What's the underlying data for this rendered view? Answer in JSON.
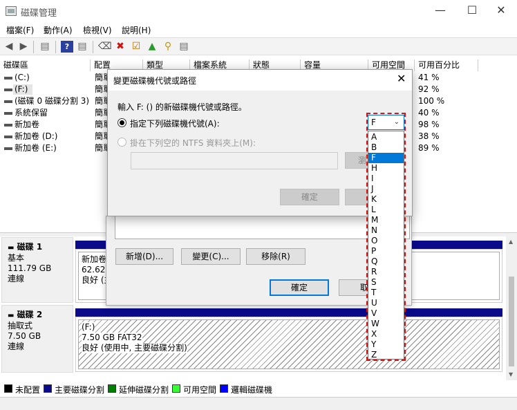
{
  "window": {
    "title": "磁碟管理",
    "minimize": "—",
    "maximize": "☐",
    "close": "✕"
  },
  "menu": [
    "檔案(F)",
    "動作(A)",
    "檢視(V)",
    "說明(H)"
  ],
  "volume_columns": [
    "磁碟區",
    "配置",
    "類型",
    "檔案系統",
    "狀態",
    "容量",
    "可用空間",
    "可用百分比"
  ],
  "volumes": [
    {
      "name": "(C:)",
      "layout": "簡單",
      "pct": "41 %"
    },
    {
      "name": "(F:)",
      "layout": "簡單",
      "pct": "92 %"
    },
    {
      "name": "(磁碟 0 磁碟分割 3)",
      "layout": "簡單",
      "pct": "100 %"
    },
    {
      "name": "系統保留",
      "layout": "簡單",
      "pct": "40 %"
    },
    {
      "name": "新加卷",
      "layout": "簡單",
      "pct": "98 %"
    },
    {
      "name": "新加卷 (D:)",
      "layout": "簡單",
      "pct": "38 %"
    },
    {
      "name": "新加卷 (E:)",
      "layout": "簡單",
      "pct": "89 %"
    }
  ],
  "disks": [
    {
      "title": "磁碟 1",
      "type": "基本",
      "size": "111.79 GB",
      "status": "連線",
      "part_name": "新加卷",
      "part_size": "62.62 G",
      "part_status": "良好 (主"
    },
    {
      "title": "磁碟 2",
      "type": "抽取式",
      "size": "7.50 GB",
      "status": "連線",
      "part_name": "(F:)",
      "part_size": "7.50 GB FAT32",
      "part_status": "良好 (使用中, 主要磁碟分割)"
    }
  ],
  "legend": [
    {
      "label": "未配置",
      "color": "#000000"
    },
    {
      "label": "主要磁碟分割",
      "color": "#0a0a8a"
    },
    {
      "label": "延伸磁碟分割",
      "color": "#008000"
    },
    {
      "label": "可用空間",
      "color": "#33ff33"
    },
    {
      "label": "邏輯磁碟機",
      "color": "#0000ff"
    }
  ],
  "props_dialog": {
    "add": "新增(D)...",
    "change": "變更(C)...",
    "remove": "移除(R)",
    "ok": "確定",
    "cancel": "取"
  },
  "dialog": {
    "title": "變更磁碟機代號或路徑",
    "close": "✕",
    "prompt": "輸入 F: () 的新磁碟機代號或路徑。",
    "opt_letter": "指定下列磁碟機代號(A):",
    "opt_folder": "掛在下列空的 NTFS 資料夾上(M):",
    "browse": "瀏",
    "ok": "確定",
    "cancel": ""
  },
  "dropdown": {
    "selected": "F",
    "options": [
      "A",
      "B",
      "F",
      "H",
      "I",
      "J",
      "K",
      "L",
      "M",
      "N",
      "O",
      "P",
      "Q",
      "R",
      "S",
      "T",
      "U",
      "V",
      "W",
      "X",
      "Y",
      "Z"
    ]
  },
  "colors": {
    "accent": "#0078d7",
    "highlight_frame": "#e01010"
  }
}
